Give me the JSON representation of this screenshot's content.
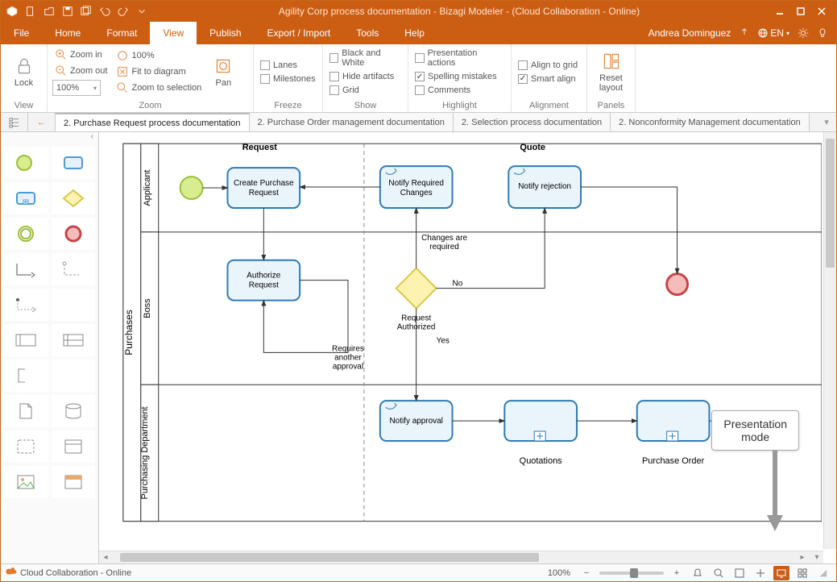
{
  "titlebar": {
    "title": "Agility Corp process documentation - Bizagi Modeler - (Cloud Collaboration - Online)"
  },
  "menu": {
    "file": "File",
    "tabs": [
      "Home",
      "Format",
      "View",
      "Publish",
      "Export / Import",
      "Tools",
      "Help"
    ],
    "active": "View",
    "user": "Andrea Dominguez",
    "lang": "EN"
  },
  "ribbon": {
    "zoom_combo": "100%",
    "view": {
      "lock": "Lock",
      "label": "View"
    },
    "zoom": {
      "in": "Zoom in",
      "out": "Zoom out",
      "hundred": "100%",
      "fit": "Fit to diagram",
      "selection": "Zoom to selection",
      "pan": "Pan",
      "label": "Zoom"
    },
    "freeze": {
      "lanes": "Lanes",
      "milestones": "Milestones",
      "label": "Freeze"
    },
    "show": {
      "bw": "Black and White",
      "hide": "Hide artifacts",
      "grid": "Grid",
      "label": "Show"
    },
    "highlight": {
      "pres": "Presentation actions",
      "spell": "Spelling mistakes",
      "comments": "Comments",
      "label": "Highlight"
    },
    "align": {
      "grid": "Align to grid",
      "smart": "Smart align",
      "label": "Alignment"
    },
    "panels": {
      "reset": "Reset layout",
      "label": "Panels"
    }
  },
  "doctabs": {
    "active": "2. Purchase Request process documentation",
    "others": [
      "2. Purchase Order management documentation",
      "2. Selection process documentation",
      "2. Nonconformity Management documentation"
    ]
  },
  "diagram": {
    "pool": "Purchases",
    "lanes": [
      "Applicant",
      "Boss",
      "Purchasing Department"
    ],
    "milestones": [
      "Request",
      "Quote"
    ],
    "tasks": {
      "create": "Create Purchase Request",
      "authorize": "Authorize Request",
      "notify_changes": "Notify Required Changes",
      "notify_reject": "Notify rejection",
      "notify_approval": "Notify approval"
    },
    "labels": {
      "changes_required": "Changes are required",
      "no": "No",
      "req_auth": "Request Authorized",
      "yes": "Yes",
      "another": "Requires another approval",
      "quotations": "Quotations",
      "purchase_order": "Purchase Order"
    }
  },
  "tooltip": {
    "line1": "Presentation",
    "line2": "mode"
  },
  "status": {
    "text": "Cloud Collaboration - Online",
    "zoom": "100%"
  }
}
